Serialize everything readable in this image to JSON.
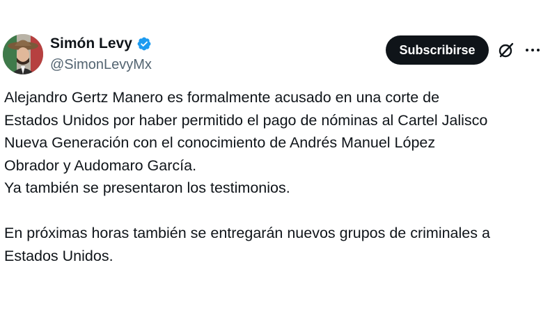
{
  "author": {
    "display_name": "Simón Levy",
    "handle": "@SimonLevyMx",
    "verified": true,
    "verified_color": "#1d9bf0"
  },
  "actions": {
    "subscribe_label": "Subscribirse",
    "grok_icon": "grok-icon",
    "more_icon": "more-options-icon"
  },
  "tweet": {
    "lines_block1": [
      "Alejandro Gertz Manero es formalmente acusado en una corte de",
      "Estados Unidos por haber permitido el pago de nóminas al Cartel Jalisco",
      "Nueva Generación con el conocimiento de Andrés Manuel López",
      "Obrador y Audomaro García.",
      "Ya también se presentaron los testimonios."
    ],
    "lines_block2": [
      "En próximas horas también se entregarán nuevos grupos de criminales a",
      "Estados Unidos."
    ]
  },
  "colors": {
    "text": "#0f1419",
    "secondary": "#536471",
    "button_bg": "#0f1419",
    "button_text": "#ffffff"
  }
}
